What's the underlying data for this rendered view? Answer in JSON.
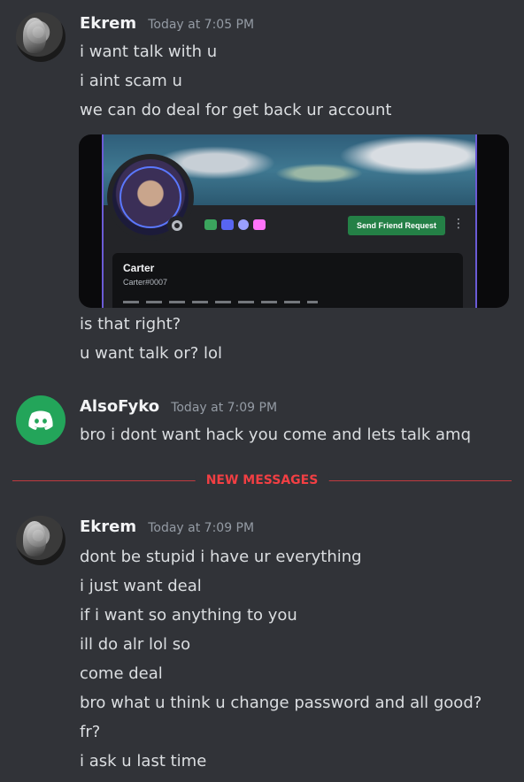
{
  "messages": [
    {
      "username": "Ekrem",
      "timestamp": "Today at 7:05 PM",
      "lines_before": [
        "i want talk with u",
        "i aint scam u",
        "we can do deal for  get back ur account"
      ],
      "embed": {
        "profile_name": "Carter",
        "profile_tag": "Carter#0007",
        "button_label": "Send Friend Request",
        "more_icon": "⋮"
      },
      "lines_after": [
        "is that right?",
        "u want talk or? lol"
      ]
    },
    {
      "username": "AlsoFyko",
      "timestamp": "Today at 7:09 PM",
      "lines": [
        "bro i dont want hack you come and lets talk amq"
      ]
    },
    {
      "username": "Ekrem",
      "timestamp": "Today at 7:09 PM",
      "lines": [
        "dont be stupid i have ur everything",
        "i just want deal",
        "if i want so anything to you",
        "ill do alr lol so",
        "come deal",
        "bro what u think u change password and all good?",
        "fr?",
        "i ask u last time"
      ]
    }
  ],
  "divider": {
    "label": "NEW MESSAGES"
  },
  "colors": {
    "background": "#313338",
    "new_messages": "#f23f43",
    "discord_avatar": "#23a55a",
    "friend_button": "#248046"
  }
}
